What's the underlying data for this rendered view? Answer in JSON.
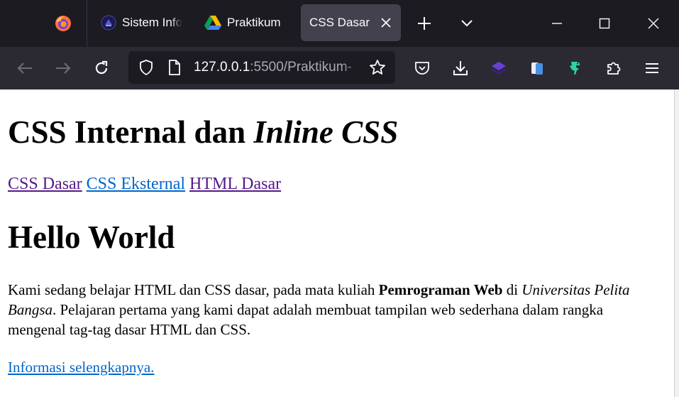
{
  "browser": {
    "tabs": [
      {
        "label": "Sistem Info",
        "icon": "university-logo-icon",
        "active": false
      },
      {
        "label": "Praktikum",
        "icon": "google-drive-icon",
        "active": false
      },
      {
        "label": "CSS Dasar",
        "icon": null,
        "active": true
      }
    ],
    "url": {
      "host": "127.0.0.1",
      "rest": ":5500/Praktikum-"
    },
    "colors": {
      "tabbar": "#1c1b22",
      "toolbar": "#2b2a33",
      "active_tab": "#42414d",
      "text": "#fbfbfe"
    }
  },
  "page": {
    "title_plain": "CSS Internal dan ",
    "title_italic": "Inline CSS",
    "nav_links": [
      {
        "label": "CSS Dasar",
        "visited": true
      },
      {
        "label": "CSS Eksternal",
        "visited": false
      },
      {
        "label": "HTML Dasar",
        "visited": true
      }
    ],
    "heading": "Hello World",
    "paragraph": {
      "part1": "Kami sedang belajar HTML dan CSS dasar, pada mata kuliah ",
      "bold": "Pemrograman Web",
      "part2": " di ",
      "italic": "Universitas Pelita Bangsa",
      "part3": ". Pelajaran pertama yang kami dapat adalah membuat tampilan web sederhana dalam rangka mengenal tag-tag dasar HTML dan CSS."
    },
    "more_link": "Informasi selengkapnya.",
    "colors": {
      "link_visited": "#551a8b",
      "link_unvisited": "#0066cc"
    }
  }
}
